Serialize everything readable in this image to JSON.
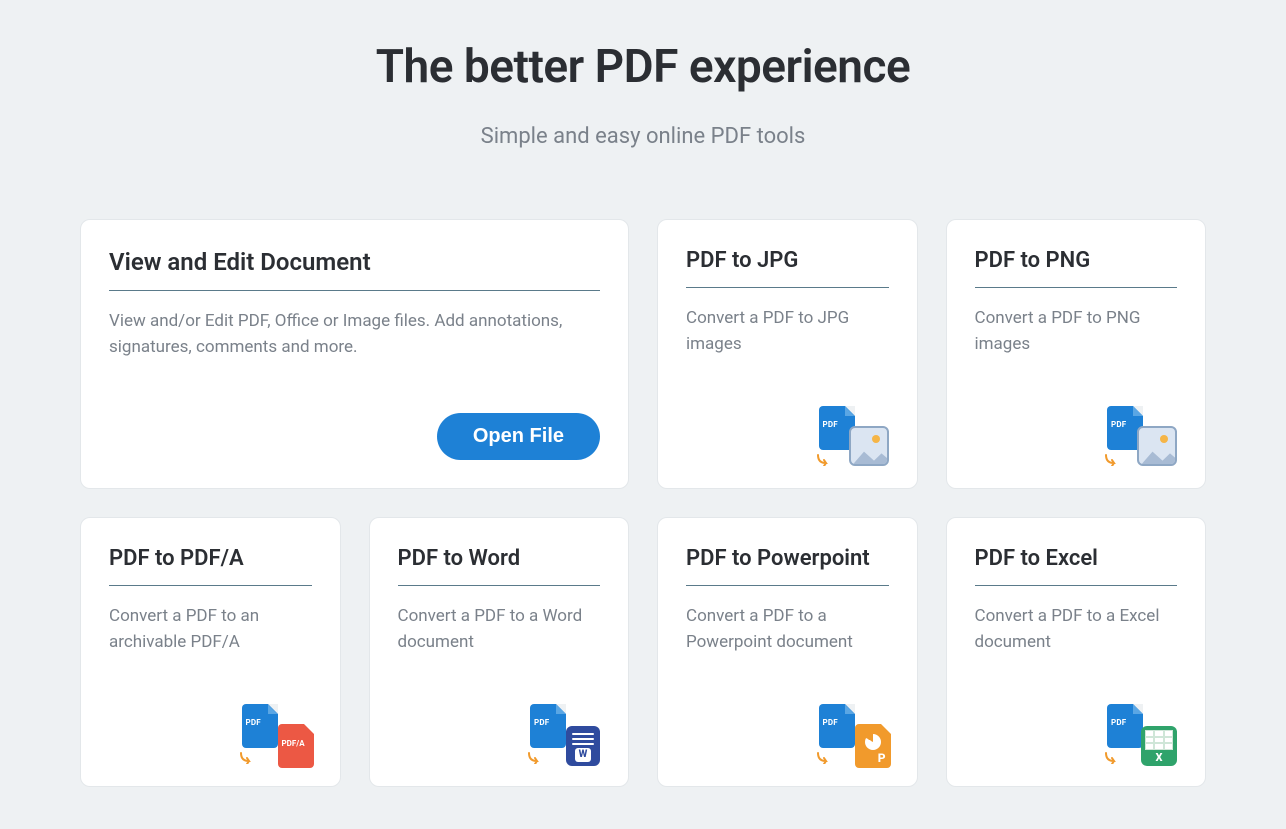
{
  "hero": {
    "title": "The better PDF experience",
    "subtitle": "Simple and easy online PDF tools"
  },
  "featuredCard": {
    "title": "View and Edit Document",
    "desc": "View and/or Edit PDF, Office or Image files. Add annotations, signatures, comments and more.",
    "button": "Open File"
  },
  "cards": {
    "pdfToJpg": {
      "title": "PDF to JPG",
      "desc": "Convert a PDF to JPG images"
    },
    "pdfToPng": {
      "title": "PDF to PNG",
      "desc": "Convert a PDF to PNG images"
    },
    "pdfToPdfa": {
      "title": "PDF to PDF/A",
      "desc": "Convert a PDF to an archivable PDF/A"
    },
    "pdfToWord": {
      "title": "PDF to Word",
      "desc": "Convert a PDF to a Word document"
    },
    "pdfToPpt": {
      "title": "PDF to Powerpoint",
      "desc": "Convert a PDF to a Powerpoint document"
    },
    "pdfToExcel": {
      "title": "PDF to Excel",
      "desc": "Convert a PDF to a Excel document"
    }
  },
  "iconLabels": {
    "pdf": "PDF",
    "pdfa": "PDF/A"
  }
}
